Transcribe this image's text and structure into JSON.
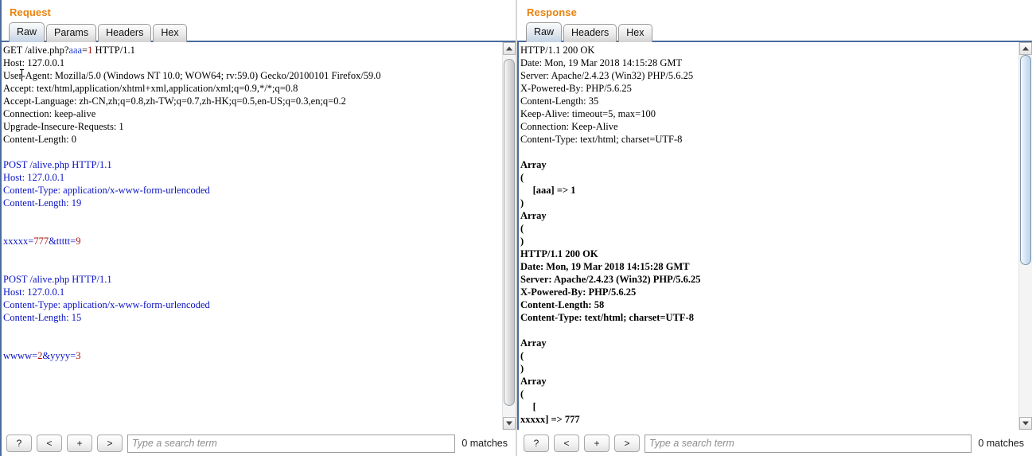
{
  "colors": {
    "panel_title": "#e8820c",
    "accent_border": "#4a6d9c",
    "header_name": "#1f3fd0",
    "header_value": "#aa1111",
    "body_blue": "#0a12c4",
    "background": "#ffffff"
  },
  "request": {
    "title": "Request",
    "tabs": [
      {
        "label": "Raw",
        "active": true
      },
      {
        "label": "Params",
        "active": false
      },
      {
        "label": "Headers",
        "active": false
      },
      {
        "label": "Hex",
        "active": false
      }
    ],
    "content_lines": [
      "GET /alive.php?aaa=1 HTTP/1.1",
      "Host: 127.0.0.1",
      "User-Agent: Mozilla/5.0 (Windows NT 10.0; WOW64; rv:59.0) Gecko/20100101 Firefox/59.0",
      "Accept: text/html,application/xhtml+xml,application/xml;q=0.9,*/*;q=0.8",
      "Accept-Language: zh-CN,zh;q=0.8,zh-TW;q=0.7,zh-HK;q=0.5,en-US;q=0.3,en;q=0.2",
      "Connection: keep-alive",
      "Upgrade-Insecure-Requests: 1",
      "Content-Length: 0",
      "",
      "POST /alive.php HTTP/1.1",
      "Host: 127.0.0.1",
      "Content-Type: application/x-www-form-urlencoded",
      "Content-Length: 19",
      "",
      "",
      "xxxxx=777&ttttt=9",
      "",
      "",
      "POST /alive.php HTTP/1.1",
      "Host: 127.0.0.1",
      "Content-Type: application/x-www-form-urlencoded",
      "Content-Length: 15",
      "",
      "",
      "wwww=2&yyyy=3"
    ],
    "query_param_name": "aaa",
    "query_param_value": "1",
    "body1_keys": [
      "xxxxx",
      "ttttt"
    ],
    "body1_values": [
      "777",
      "9"
    ],
    "body2_keys": [
      "wwww",
      "yyyy"
    ],
    "body2_values": [
      "2",
      "3"
    ],
    "scrollbar": {
      "thumb_style": "grey",
      "thumb_top_pct": 1,
      "thumb_height_pct": 96
    },
    "search": {
      "help_label": "?",
      "prev_label": "<",
      "add_label": "+",
      "next_label": ">",
      "placeholder": "Type a search term",
      "value": "",
      "matches": "0 matches"
    }
  },
  "response": {
    "title": "Response",
    "tabs": [
      {
        "label": "Raw",
        "active": true
      },
      {
        "label": "Headers",
        "active": false
      },
      {
        "label": "Hex",
        "active": false
      }
    ],
    "headers_block1": [
      "HTTP/1.1 200 OK",
      "Date: Mon, 19 Mar 2018 14:15:28 GMT",
      "Server: Apache/2.4.23 (Win32) PHP/5.6.25",
      "X-Powered-By: PHP/5.6.25",
      "Content-Length: 35",
      "Keep-Alive: timeout=5, max=100",
      "Connection: Keep-Alive",
      "Content-Type: text/html; charset=UTF-8"
    ],
    "body_block1": [
      "",
      "Array",
      "(",
      "    [aaa] => 1",
      ")"
    ],
    "bold_block": [
      "Array",
      "(",
      ")",
      "HTTP/1.1 200 OK",
      "Date: Mon, 19 Mar 2018 14:15:28 GMT",
      "Server: Apache/2.4.23 (Win32) PHP/5.6.25",
      "X-Powered-By: PHP/5.6.25",
      "Content-Length: 58",
      "Content-Type: text/html; charset=UTF-8"
    ],
    "body_block2": [
      "",
      "Array",
      "(",
      ")",
      "Array",
      "(",
      "     [",
      "xxxxx] => 777"
    ],
    "scrollbar": {
      "thumb_style": "blue",
      "thumb_top_pct": 0,
      "thumb_height_pct": 58
    },
    "search": {
      "help_label": "?",
      "prev_label": "<",
      "add_label": "+",
      "next_label": ">",
      "placeholder": "Type a search term",
      "value": "",
      "matches": "0 matches"
    }
  }
}
